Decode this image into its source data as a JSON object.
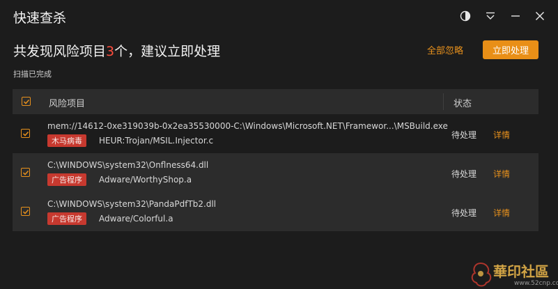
{
  "window": {
    "title": "快速查杀",
    "controls": [
      "theme-icon",
      "dropdown-icon",
      "minimize-icon",
      "close-icon"
    ]
  },
  "summary": {
    "prefix": "共发现风险项目",
    "count": "3",
    "suffix": "个，建议立即处理",
    "ignore_all_label": "全部忽略",
    "handle_now_label": "立即处理",
    "scan_status": "扫描已完成"
  },
  "table": {
    "headers": {
      "name": "风险项目",
      "status": "状态"
    },
    "rows": [
      {
        "path": "mem://14612-0xe319039b-0x2ea35530000-C:\\Windows\\Microsoft.NET\\Framewor...\\MSBuild.exe",
        "tag": "木马病毒",
        "threat": "HEUR:Trojan/MSIL.Injector.c",
        "status": "待处理",
        "details": "详情",
        "checked": true
      },
      {
        "path": "C:\\WINDOWS\\system32\\Onflness64.dll",
        "tag": "广告程序",
        "threat": "Adware/WorthyShop.a",
        "status": "待处理",
        "details": "详情",
        "checked": true
      },
      {
        "path": "C:\\WINDOWS\\system32\\PandaPdfTb2.dll",
        "tag": "广告程序",
        "threat": "Adware/Colorful.a",
        "status": "待处理",
        "details": "详情",
        "checked": true
      }
    ]
  },
  "watermark": {
    "text": "華印社區",
    "url": "www.52cnp.com"
  },
  "colors": {
    "background": "#1c1c1c",
    "accent": "#e98f17",
    "danger": "#ff4d3d",
    "tag": "#c7392f"
  }
}
